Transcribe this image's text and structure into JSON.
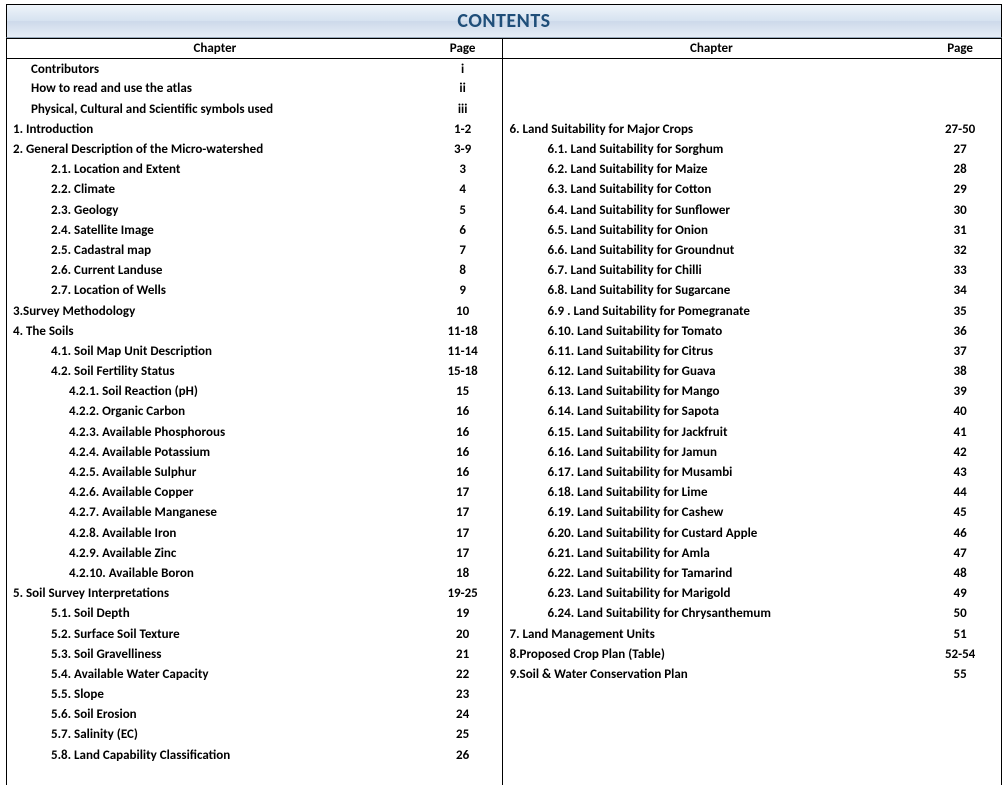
{
  "title": "CONTENTS",
  "col1": "Chapter",
  "col2": "Page",
  "col3": "Chapter",
  "col4": "Page",
  "left": [
    {
      "t": "Contributors",
      "p": "i",
      "i": 1
    },
    {
      "t": "How to read and use the atlas",
      "p": "ii",
      "i": 1
    },
    {
      "t": "Physical, Cultural and Scientific symbols used",
      "p": "iii",
      "i": 1
    },
    {
      "t": "1. Introduction",
      "p": "1-2",
      "i": 0
    },
    {
      "t": "2. General Description of the Micro-watershed",
      "p": "3-9",
      "i": 0
    },
    {
      "t": "2.1. Location and Extent",
      "p": "3",
      "i": 2
    },
    {
      "t": "2.2. Climate",
      "p": "4",
      "i": 2
    },
    {
      "t": "2.3. Geology",
      "p": "5",
      "i": 2
    },
    {
      "t": "2.4. Satellite Image",
      "p": "6",
      "i": 2
    },
    {
      "t": "2.5. Cadastral map",
      "p": "7",
      "i": 2
    },
    {
      "t": "2.6. Current Landuse",
      "p": "8",
      "i": 2
    },
    {
      "t": "2.7. Location of Wells",
      "p": "9",
      "i": 2
    },
    {
      "t": "3.Survey Methodology",
      "p": "10",
      "i": 0
    },
    {
      "t": "4. The Soils",
      "p": "11-18",
      "i": 0
    },
    {
      "t": "4.1. Soil Map Unit Description",
      "p": "11-14",
      "i": 2
    },
    {
      "t": "4.2. Soil Fertility Status",
      "p": "15-18",
      "i": 2
    },
    {
      "t": "4.2.1. Soil Reaction (pH)",
      "p": "15",
      "i": 3
    },
    {
      "t": "4.2.2. Organic Carbon",
      "p": "16",
      "i": 3
    },
    {
      "t": "4.2.3. Available  Phosphorous",
      "p": "16",
      "i": 3
    },
    {
      "t": "4.2.4. Available  Potassium",
      "p": "16",
      "i": 3
    },
    {
      "t": "4.2.5. Available Sulphur",
      "p": "16",
      "i": 3
    },
    {
      "t": "4.2.6. Available Copper",
      "p": "17",
      "i": 3
    },
    {
      "t": "4.2.7. Available Manganese",
      "p": "17",
      "i": 3
    },
    {
      "t": "4.2.8. Available Iron",
      "p": "17",
      "i": 3
    },
    {
      "t": "4.2.9. Available Zinc",
      "p": "17",
      "i": 3
    },
    {
      "t": "4.2.10. Available Boron",
      "p": "18",
      "i": 3
    },
    {
      "t": "5. Soil Survey Interpretations",
      "p": "19-25",
      "i": 0
    },
    {
      "t": "5.1. Soil Depth",
      "p": "19",
      "i": 2
    },
    {
      "t": "5.2. Surface Soil Texture",
      "p": "20",
      "i": 2
    },
    {
      "t": "5.3. Soil Gravelliness",
      "p": "21",
      "i": 2
    },
    {
      "t": "5.4. Available Water Capacity",
      "p": "22",
      "i": 2
    },
    {
      "t": "5.5. Slope",
      "p": "23",
      "i": 2
    },
    {
      "t": "5.6. Soil Erosion",
      "p": "24",
      "i": 2
    },
    {
      "t": "5.7. Salinity (EC)",
      "p": "25",
      "i": 2
    },
    {
      "t": "5.8. Land Capability Classification",
      "p": "26",
      "i": 2
    }
  ],
  "right": [
    {
      "t": "",
      "p": ""
    },
    {
      "t": "",
      "p": ""
    },
    {
      "t": "",
      "p": ""
    },
    {
      "t": "6. Land Suitability for Major Crops",
      "p": "27-50",
      "i": 0
    },
    {
      "t": "6.1. Land Suitability for Sorghum",
      "p": "27",
      "i": 2
    },
    {
      "t": "6.2. Land Suitability for Maize",
      "p": "28",
      "i": 2
    },
    {
      "t": "6.3. Land Suitability for Cotton",
      "p": "29",
      "i": 2
    },
    {
      "t": "6.4. Land Suitability for Sunflower",
      "p": "30",
      "i": 2
    },
    {
      "t": "6.5. Land Suitability for Onion",
      "p": "31",
      "i": 2
    },
    {
      "t": "6.6. Land Suitability for Groundnut",
      "p": "32",
      "i": 2
    },
    {
      "t": "6.7. Land Suitability for Chilli",
      "p": "33",
      "i": 2
    },
    {
      "t": "6.8.  Land Suitability for Sugarcane",
      "p": "34",
      "i": 2
    },
    {
      "t": "6.9 . Land Suitability for Pomegranate",
      "p": "35",
      "i": 2
    },
    {
      "t": "6.10. Land Suitability for Tomato",
      "p": "36",
      "i": 2
    },
    {
      "t": "6.11. Land Suitability for Citrus",
      "p": "37",
      "i": 2
    },
    {
      "t": "6.12. Land Suitability for Guava",
      "p": "38",
      "i": 2
    },
    {
      "t": "6.13. Land Suitability for Mango",
      "p": "39",
      "i": 2
    },
    {
      "t": "6.14. Land Suitability for Sapota",
      "p": "40",
      "i": 2
    },
    {
      "t": "6.15. Land Suitability for Jackfruit",
      "p": "41",
      "i": 2
    },
    {
      "t": "6.16. Land Suitability for Jamun",
      "p": "42",
      "i": 2
    },
    {
      "t": "6.17. Land Suitability for Musambi",
      "p": "43",
      "i": 2
    },
    {
      "t": "6.18. Land Suitability for Lime",
      "p": "44",
      "i": 2
    },
    {
      "t": "6.19. Land Suitability for Cashew",
      "p": "45",
      "i": 2
    },
    {
      "t": "6.20. Land Suitability for Custard Apple",
      "p": "46",
      "i": 2
    },
    {
      "t": "6.21. Land Suitability for Amla",
      "p": "47",
      "i": 2
    },
    {
      "t": "6.22. Land Suitability for Tamarind",
      "p": "48",
      "i": 2
    },
    {
      "t": "6.23. Land Suitability for Marigold",
      "p": "49",
      "i": 2
    },
    {
      "t": "6.24. Land Suitability for Chrysanthemum",
      "p": "50",
      "i": 2
    },
    {
      "t": "7.  Land Management Units",
      "p": "51",
      "i": 0
    },
    {
      "t": "8.Proposed Crop Plan (Table)",
      "p": "52-54",
      "i": 0
    },
    {
      "t": "9.Soil & Water Conservation Plan",
      "p": "55",
      "i": 0
    },
    {
      "t": "",
      "p": ""
    },
    {
      "t": "",
      "p": ""
    },
    {
      "t": "",
      "p": ""
    },
    {
      "t": "",
      "p": ""
    },
    {
      "t": "",
      "p": ""
    }
  ]
}
